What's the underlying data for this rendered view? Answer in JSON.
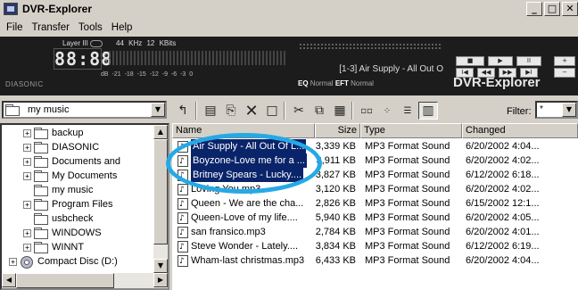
{
  "window": {
    "title": "DVR-Explorer",
    "minimize": "_",
    "maximize": "□",
    "close": "✕"
  },
  "menu": [
    "File",
    "Transfer",
    "Tools",
    "Help"
  ],
  "player": {
    "brand_small": "DIASONIC",
    "layer": "Layer III",
    "time": "88:88",
    "khz": "44 KHz",
    "kbits": "12 KBits",
    "meter_l": "L",
    "meter_r": "R",
    "db_scale": "dB -21 -18 -15 -12 -9 -6 -3 0",
    "track": "[1-3] Air Supply - All Out O",
    "eq_label": "EQ",
    "eq_value": "Normal",
    "eft_label": "EFT",
    "eft_value": "Normal",
    "brand_big": "DVR-Explorer",
    "controls": {
      "stop": "■",
      "play": "▶",
      "pause": "II",
      "prev": "I◀",
      "rew": "◀◀",
      "ff": "▶▶",
      "next": "▶I",
      "vol_up": "+",
      "vol_down": "−"
    }
  },
  "toolbar": {
    "folder": "my music",
    "filter_label": "Filter:",
    "filter_value": "*"
  },
  "tree": {
    "items": [
      {
        "label": "backup",
        "expand": "+"
      },
      {
        "label": "DIASONIC",
        "expand": "+"
      },
      {
        "label": "Documents and",
        "expand": "+"
      },
      {
        "label": "My Documents",
        "expand": "+"
      },
      {
        "label": "my music",
        "expand": ""
      },
      {
        "label": "Program Files",
        "expand": "+"
      },
      {
        "label": "usbcheck",
        "expand": ""
      },
      {
        "label": "WINDOWS",
        "expand": "+"
      },
      {
        "label": "WINNT",
        "expand": "+"
      },
      {
        "label": "Compact Disc (D:)",
        "expand": "+"
      }
    ]
  },
  "list": {
    "columns": [
      "Name",
      "Size",
      "Type",
      "Changed"
    ],
    "rows": [
      {
        "name": "Air Supply - All Out Of L...",
        "size": "3,339 KB",
        "type": "MP3 Format Sound",
        "changed": "6/20/2002 4:04...",
        "selected": true
      },
      {
        "name": "Boyzone-Love me for a ...",
        "size": "3,911 KB",
        "type": "MP3 Format Sound",
        "changed": "6/20/2002 4:02...",
        "selected": true
      },
      {
        "name": "Britney Spears - Lucky....",
        "size": "3,827 KB",
        "type": "MP3 Format Sound",
        "changed": "6/12/2002 6:18...",
        "selected": true
      },
      {
        "name": "Loving You.mp3",
        "size": "3,120 KB",
        "type": "MP3 Format Sound",
        "changed": "6/20/2002 4:02...",
        "selected": false
      },
      {
        "name": "Queen - We are the cha...",
        "size": "2,826 KB",
        "type": "MP3 Format Sound",
        "changed": "6/15/2002 12:1...",
        "selected": false
      },
      {
        "name": "Queen-Love of my life....",
        "size": "5,940 KB",
        "type": "MP3 Format Sound",
        "changed": "6/20/2002 4:05...",
        "selected": false
      },
      {
        "name": "san fransico.mp3",
        "size": "2,784 KB",
        "type": "MP3 Format Sound",
        "changed": "6/20/2002 4:01...",
        "selected": false
      },
      {
        "name": "Steve Wonder - Lately....",
        "size": "3,834 KB",
        "type": "MP3 Format Sound",
        "changed": "6/12/2002 6:19...",
        "selected": false
      },
      {
        "name": "Wham-last christmas.mp3",
        "size": "6,433 KB",
        "type": "MP3 Format Sound",
        "changed": "6/20/2002 4:04...",
        "selected": false
      }
    ]
  },
  "colors": {
    "selection": "#0a246a",
    "highlight_ring": "#25a9e6",
    "player_bg": "#1c1c1c"
  }
}
